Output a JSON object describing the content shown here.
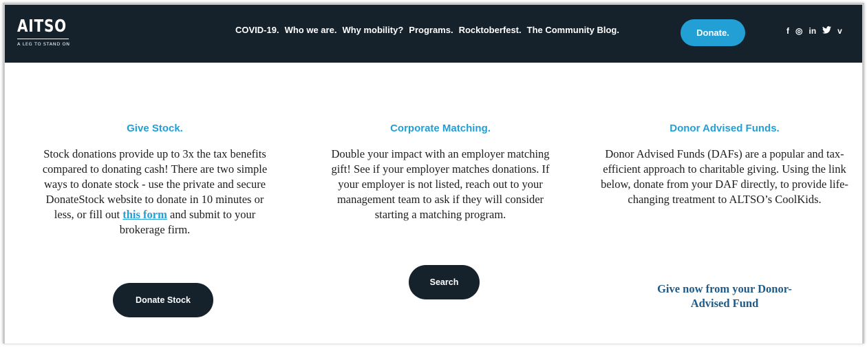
{
  "header": {
    "logo": {
      "main": "AITSO",
      "tagline": "A LEG TO STAND ON"
    },
    "nav": [
      {
        "label": "COVID-19."
      },
      {
        "label": "Who we are."
      },
      {
        "label": "Why mobility?"
      },
      {
        "label": "Programs."
      },
      {
        "label": "Rocktoberfest."
      },
      {
        "label": "The Community Blog."
      }
    ],
    "donate_label": "Donate.",
    "socials": [
      {
        "icon": "facebook-icon",
        "glyph": "f"
      },
      {
        "icon": "instagram-icon",
        "glyph": "◎"
      },
      {
        "icon": "linkedin-icon",
        "glyph": "in"
      },
      {
        "icon": "twitter-icon",
        "glyph": "🐦"
      },
      {
        "icon": "vimeo-icon",
        "glyph": "v"
      }
    ]
  },
  "give_stock": {
    "title": "Give Stock.",
    "text_before": "Stock donations provide up to 3x the tax benefits compared to donating cash! There are two simple ways to donate stock - use the private and secure DonateStock website to donate in 10 minutes or less, or fill out ",
    "link": "this form",
    "text_after": " and submit to your brokerage firm.",
    "button": "Donate Stock"
  },
  "corporate_matching": {
    "title": "Corporate Matching.",
    "text": "Double your impact with an employer matching gift! See if your employer matches donations. If your employer is not listed, reach out to your management team to ask if they will consider starting a matching program.",
    "button": "Search"
  },
  "donor_advised": {
    "title": "Donor Advised Funds.",
    "text": "Donor Advised Funds (DAFs) are a popular and tax-efficient approach to charitable giving. Using the link below, donate from your DAF directly, to provide life-changing treatment to ALTSO’s CoolKids.",
    "link": "Give now from your Donor-Advised Fund"
  },
  "colors": {
    "header_bg": "#15212b",
    "accent": "#22a0d6",
    "link_dark": "#1f5a86"
  }
}
